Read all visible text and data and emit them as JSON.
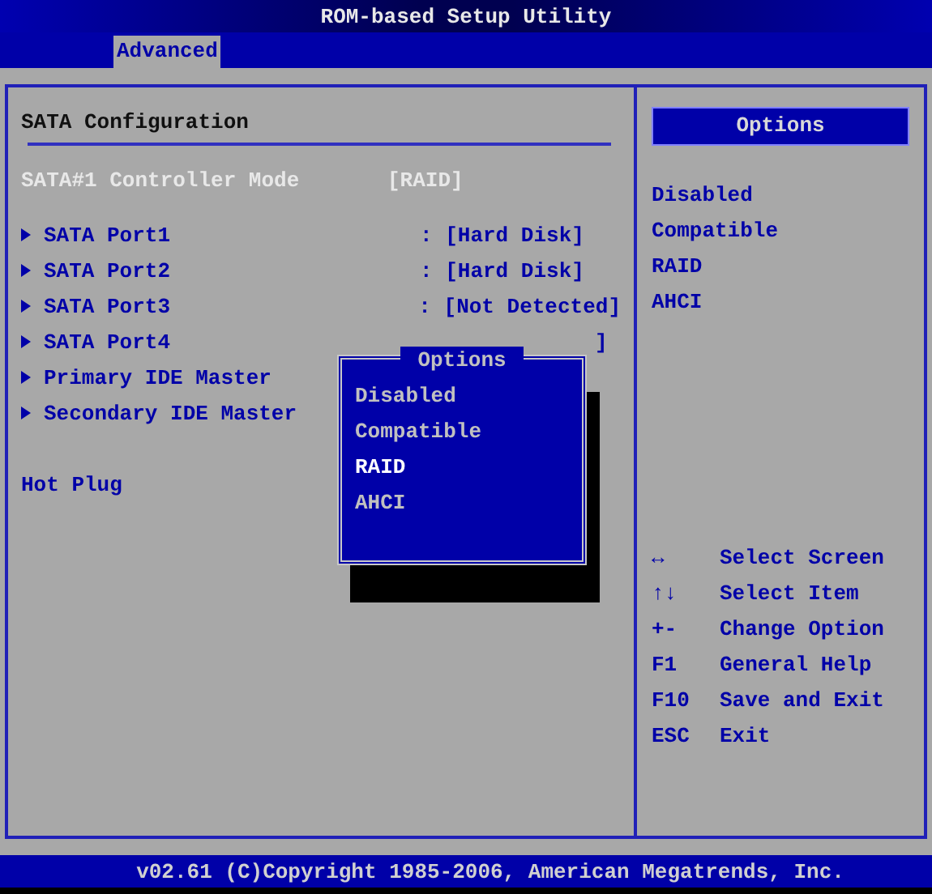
{
  "window": {
    "title": "ROM-based Setup Utility"
  },
  "tabs": [
    {
      "label": "Advanced",
      "selected": true
    }
  ],
  "section": {
    "title": "SATA Configuration"
  },
  "items": [
    {
      "kind": "setting",
      "label": "SATA#1 Controller Mode",
      "value": "[RAID]",
      "selected": true
    },
    {
      "kind": "submenu",
      "label": "SATA Port1",
      "value": ": [Hard Disk]",
      "selected": false
    },
    {
      "kind": "submenu",
      "label": "SATA Port2",
      "value": ": [Hard Disk]",
      "selected": false
    },
    {
      "kind": "submenu",
      "label": "SATA Port3",
      "value": ": [Not Detected]",
      "selected": false
    },
    {
      "kind": "submenu",
      "label": "SATA Port4",
      "value": "]",
      "selected": false
    },
    {
      "kind": "submenu",
      "label": "Primary IDE Master",
      "selected": false
    },
    {
      "kind": "submenu",
      "label": "Secondary IDE Master",
      "selected": false
    },
    {
      "kind": "gap"
    },
    {
      "kind": "setting",
      "label": "Hot Plug",
      "selected": false
    }
  ],
  "popup": {
    "title": "Options",
    "options": [
      {
        "label": "Disabled",
        "selected": false
      },
      {
        "label": "Compatible",
        "selected": false
      },
      {
        "label": "RAID",
        "selected": true
      },
      {
        "label": "AHCI",
        "selected": false
      }
    ]
  },
  "help": {
    "title": "Options",
    "options": [
      "Disabled",
      "Compatible",
      "RAID",
      "AHCI"
    ],
    "keys": [
      {
        "key": "↔",
        "action": "Select Screen"
      },
      {
        "key": "↑↓",
        "action": "Select Item"
      },
      {
        "key": "+-",
        "action": "Change Option"
      },
      {
        "key": "F1",
        "action": "General Help"
      },
      {
        "key": "F10",
        "action": "Save and Exit"
      },
      {
        "key": "ESC",
        "action": "Exit"
      }
    ]
  },
  "status_bar": {
    "text": "v02.61 (C)Copyright 1985-2006, American Megatrends, Inc."
  }
}
